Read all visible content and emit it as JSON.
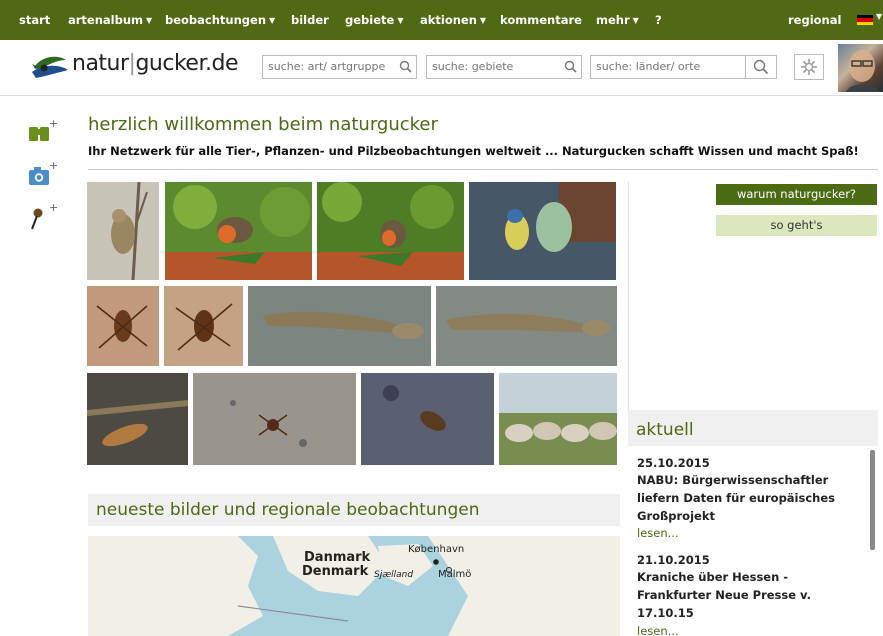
{
  "nav": {
    "items": [
      {
        "label": "start",
        "caret": false
      },
      {
        "label": "artenalbum",
        "caret": true
      },
      {
        "label": "beobachtungen",
        "caret": true
      },
      {
        "label": "bilder",
        "caret": false
      },
      {
        "label": "gebiete",
        "caret": true
      },
      {
        "label": "aktionen",
        "caret": true
      },
      {
        "label": "kommentare",
        "caret": false
      },
      {
        "label": "mehr",
        "caret": true
      },
      {
        "label": "?",
        "caret": false
      }
    ],
    "regional": "regional",
    "colors": {
      "bar": "#4f6a12",
      "text": "#ffffff"
    }
  },
  "header": {
    "logo_text_left": "natur",
    "logo_text_right": "gucker.de",
    "search_art_placeholder": "suche: art/ artgruppe",
    "search_gebiete_placeholder": "suche: gebiete",
    "search_orte_placeholder": "suche: länder/ orte",
    "icons": {
      "search": "search-icon",
      "settings": "settings-gear-icon"
    }
  },
  "sidebar": {
    "icons": [
      "add-observation-binoculars-icon",
      "add-photo-camera-icon",
      "add-location-pin-icon"
    ]
  },
  "welcome": {
    "title": "herzlich willkommen beim naturgucker",
    "subtitle": "Ihr Netzwerk für alle Tier-, Pflanzen- und Pilzbeobachtungen weltweit ... Naturgucken schafft Wissen und macht Spaß!"
  },
  "buttons": {
    "why": "warum naturgucker?",
    "how": "so geht's"
  },
  "aktuell": {
    "title": "aktuell",
    "news": [
      {
        "date": "25.10.2015",
        "title": "NABU: Bürgerwissenschaftler liefern Daten für europäisches Großprojekt",
        "more": "lesen..."
      },
      {
        "date": "21.10.2015",
        "title": "Kraniche über Hessen - Frankfurter Neue Presse v. 17.10.15",
        "more": "lesen..."
      }
    ]
  },
  "neueste": {
    "title": "neueste bilder und regionale beobachtungen"
  },
  "map": {
    "labels": {
      "danmark": "Danmark",
      "denmark": "Denmark",
      "kobenhavn": "København",
      "sjaelland": "Sjælland",
      "malmo": "Malmö"
    }
  },
  "colors": {
    "accent_green": "#4a6b14",
    "light_green": "#dbe8bd",
    "panel_grey": "#f0f0f0"
  }
}
